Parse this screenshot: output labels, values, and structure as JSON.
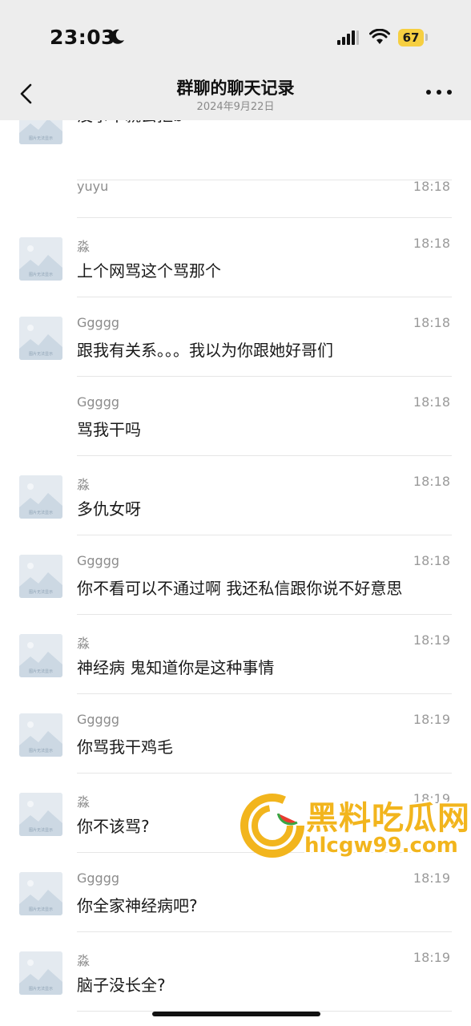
{
  "status_bar": {
    "time": "23:03",
    "battery": "67"
  },
  "nav": {
    "title": "群聊的聊天记录",
    "date": "2024年9月22日"
  },
  "avatar_placeholder_text": "图片无法显示",
  "messages": [
    {
      "sender": "",
      "time": "",
      "text": "没事干就去抠b",
      "avatar": true
    },
    {
      "sender": "yuyu",
      "time": "18:18",
      "text": "",
      "avatar": false
    },
    {
      "sender": "淼",
      "time": "18:18",
      "text": "上个网骂这个骂那个",
      "avatar": true
    },
    {
      "sender": "Ggggg",
      "time": "18:18",
      "text": "跟我有关系。。。我以为你跟她好哥们",
      "avatar": true
    },
    {
      "sender": "Ggggg",
      "time": "18:18",
      "text": "骂我干吗",
      "avatar": false
    },
    {
      "sender": "淼",
      "time": "18:18",
      "text": "多仇女呀",
      "avatar": true
    },
    {
      "sender": "Ggggg",
      "time": "18:18",
      "text": "你不看可以不通过啊 我还私信跟你说不好意思",
      "avatar": true
    },
    {
      "sender": "淼",
      "time": "18:19",
      "text": "神经病 鬼知道你是这种事情",
      "avatar": true
    },
    {
      "sender": "Ggggg",
      "time": "18:19",
      "text": "你骂我干鸡毛",
      "avatar": true
    },
    {
      "sender": "淼",
      "time": "18:19",
      "text": "你不该骂?",
      "avatar": true
    },
    {
      "sender": "Ggggg",
      "time": "18:19",
      "text": "你全家神经病吧?",
      "avatar": true
    },
    {
      "sender": "淼",
      "time": "18:19",
      "text": "脑子没长全?",
      "avatar": true
    }
  ],
  "watermark": {
    "title": "黑料吃瓜网",
    "url": "hlcgw99.com"
  },
  "colors": {
    "background": "#ffffff",
    "header": "#ededed",
    "battery": "#f6cf41",
    "watermark": "#f2b51d"
  }
}
